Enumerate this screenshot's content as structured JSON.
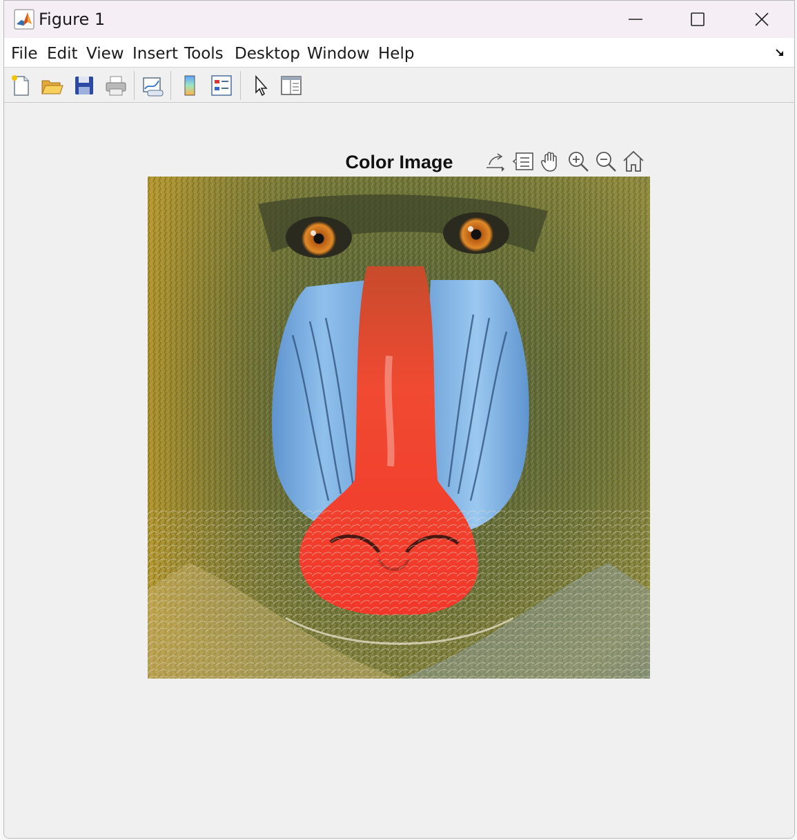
{
  "window": {
    "title": "Figure 1",
    "minimize_icon": "minimize-icon",
    "maximize_icon": "maximize-icon",
    "close_icon": "close-icon"
  },
  "menubar": {
    "items": [
      "File",
      "Edit",
      "View",
      "Insert",
      "Tools",
      "Desktop",
      "Window",
      "Help"
    ]
  },
  "toolbar": {
    "buttons": [
      {
        "name": "new-figure",
        "icon": "new-document-icon"
      },
      {
        "name": "open-file",
        "icon": "folder-open-icon"
      },
      {
        "name": "save-figure",
        "icon": "floppy-disk-icon"
      },
      {
        "name": "print-figure",
        "icon": "printer-icon"
      },
      {
        "name": "link-plot",
        "icon": "link-plot-icon"
      },
      {
        "name": "insert-colorbar",
        "icon": "colorbar-icon"
      },
      {
        "name": "insert-legend",
        "icon": "legend-icon"
      },
      {
        "name": "edit-plot",
        "icon": "arrow-cursor-icon"
      },
      {
        "name": "property-inspector",
        "icon": "property-panel-icon"
      }
    ]
  },
  "axes": {
    "title": "Color Image",
    "toolbar": [
      {
        "name": "export-icon"
      },
      {
        "name": "data-tips-icon"
      },
      {
        "name": "pan-hand-icon"
      },
      {
        "name": "zoom-in-icon"
      },
      {
        "name": "zoom-out-icon"
      },
      {
        "name": "home-restore-icon"
      }
    ]
  },
  "image": {
    "subject": "mandrill-baboon-face",
    "colors": {
      "fur": "#6e7438",
      "nose": "#f03a2a",
      "cheeks": "#7fb3e2",
      "eyes": "#d07a1c"
    }
  }
}
